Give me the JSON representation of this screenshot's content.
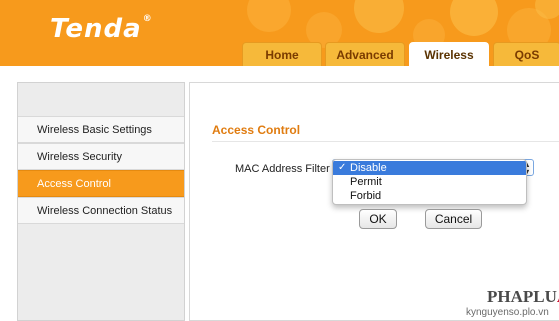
{
  "brand": {
    "logo_text": "Tenda",
    "registered": "®"
  },
  "colors": {
    "header_orange": "#f79a1c",
    "active_blue": "#3a7bdc",
    "title_orange": "#e07c10"
  },
  "tabs": [
    {
      "label": "Home",
      "active": false
    },
    {
      "label": "Advanced",
      "active": false
    },
    {
      "label": "Wireless",
      "active": true
    },
    {
      "label": "QoS",
      "active": false
    }
  ],
  "sidebar": {
    "items": [
      {
        "label": "Wireless Basic Settings",
        "active": false
      },
      {
        "label": "Wireless Security",
        "active": false
      },
      {
        "label": "Access Control",
        "active": true
      },
      {
        "label": "Wireless Connection Status",
        "active": false
      }
    ]
  },
  "main": {
    "section_title": "Access Control",
    "mac_filter_label": "MAC Address Filter",
    "dropdown": {
      "check_icon": "✓",
      "options": [
        "Disable",
        "Permit",
        "Forbid"
      ],
      "selected": "Disable"
    },
    "ok_label": "OK",
    "cancel_label": "Cancel"
  },
  "watermark": {
    "line1_a": "PHAPLU",
    "line1_b": "AT",
    "line2": "kynguyenso.plo.vn"
  }
}
